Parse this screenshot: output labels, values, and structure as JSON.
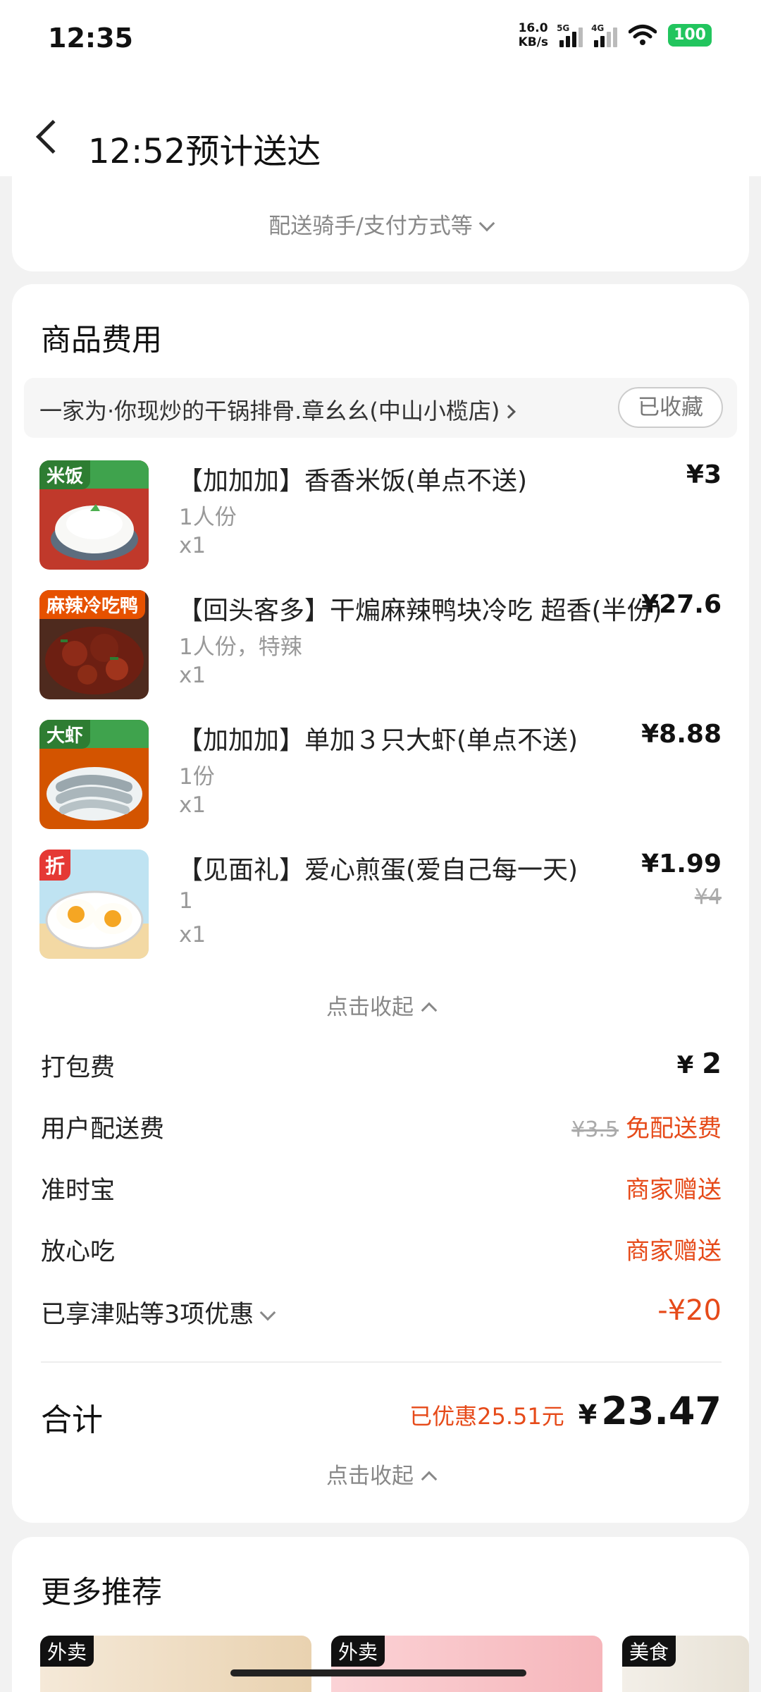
{
  "status": {
    "time": "12:35",
    "net_speed_value": "16.0",
    "net_speed_unit": "KB/s",
    "sim1": "5G",
    "sim2": "4G",
    "battery": "100"
  },
  "header": {
    "title": "12:52预计送达"
  },
  "top_card": {
    "more_info": "配送骑手/支付方式等"
  },
  "goods": {
    "section_title": "商品费用",
    "shop_name": "一家为·你现炒的干锅排骨.章幺幺(中山小榄店)",
    "fav_label": "已收藏",
    "items": [
      {
        "tag": "米饭",
        "name": "【加加加】香香米饭(单点不送)",
        "spec": "1人份",
        "qty": "x1",
        "price": "¥3",
        "original": ""
      },
      {
        "tag": "麻辣冷吃鸭",
        "name": "【回头客多】干煸麻辣鸭块冷吃 超香(半份)",
        "spec": "1人份，特辣",
        "qty": "x1",
        "price": "¥27.6",
        "original": ""
      },
      {
        "tag": "大虾",
        "name": "【加加加】单加３只大虾(单点不送)",
        "spec": "1份",
        "qty": "x1",
        "price": "¥8.88",
        "original": ""
      },
      {
        "tag": "折",
        "name": "【见面礼】爱心煎蛋(爱自己每一天)",
        "spec": "1",
        "qty": "x1",
        "price": "¥1.99",
        "original": "¥4"
      }
    ],
    "collapse_label": "点击收起"
  },
  "fees": {
    "packing_label": "打包费",
    "packing_currency": "¥",
    "packing_value": "2",
    "delivery_label": "用户配送费",
    "delivery_original": "¥3.5",
    "delivery_value": "免配送费",
    "ontime_label": "准时宝",
    "ontime_value": "商家赠送",
    "safe_label": "放心吃",
    "safe_value": "商家赠送",
    "discount_label": "已享津贴等3项优惠",
    "discount_value": "-¥20"
  },
  "total": {
    "label": "合计",
    "saved": "已优惠25.51元",
    "currency": "¥",
    "amount": "23.47",
    "collapse_label": "点击收起"
  },
  "recommend": {
    "title": "更多推荐",
    "tiles": [
      {
        "tag": "外卖"
      },
      {
        "tag": "外卖"
      },
      {
        "tag": "美食"
      }
    ]
  },
  "colors": {
    "accent_red": "#e64a19",
    "battery_green": "#22c55e"
  }
}
